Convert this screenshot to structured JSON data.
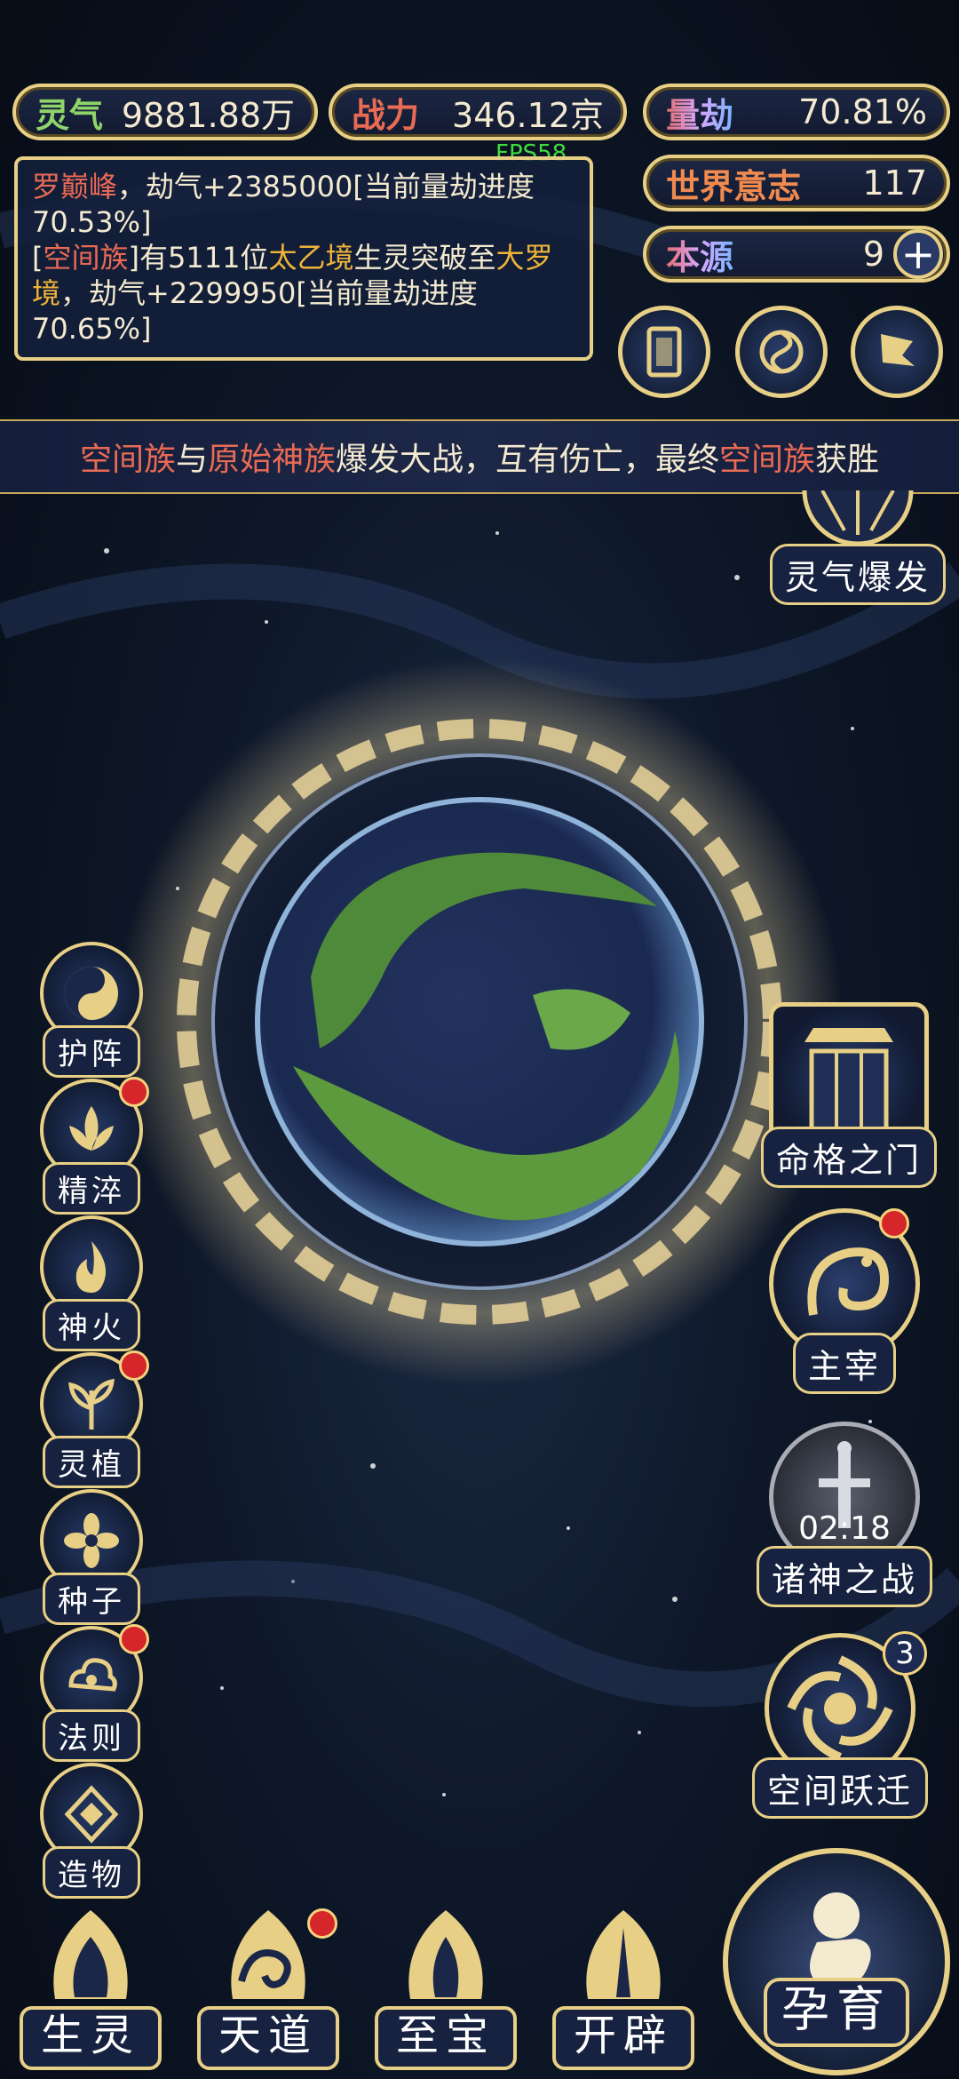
{
  "stats": {
    "lingqi": {
      "label": "灵气",
      "value": "9881.88万"
    },
    "zhanli": {
      "label": "战力",
      "value": "346.12京"
    },
    "liangjie": {
      "label": "量劫",
      "value": "70.81%"
    },
    "world_will": {
      "label": "世界意志",
      "value": "117"
    },
    "benyuan": {
      "label": "本源",
      "value": "9"
    }
  },
  "fps": "FPS58",
  "log": {
    "line1_name": "罗巅峰",
    "line1_text": "，劫气+2385000[当前量劫进度70.53%]",
    "line2_open": "[",
    "line2_clan": "空间族",
    "line2_mid": "]有5111位",
    "line2_realm1": "太乙境",
    "line2_mid2": "生灵突破至",
    "line2_realm2": "大罗境",
    "line2_end": "，劫气+2299950[当前量劫进度70.65%]"
  },
  "banner": {
    "clan_a": "空间族",
    "and": "与",
    "clan_b": "原始神族",
    "mid": "爆发大战，互有伤亡，最终",
    "winner": "空间族",
    "end": "获胜"
  },
  "right_buttons": {
    "lingqi_burst": "灵气爆发",
    "fate_gate": "命格之门",
    "ruler": "主宰",
    "gods_war": "诸神之战",
    "gods_war_timer": "02:18",
    "space_jump": "空间跃迁",
    "space_jump_count": "3"
  },
  "left_skills": [
    "护阵",
    "精淬",
    "神火",
    "灵植",
    "种子",
    "法则",
    "造物"
  ],
  "bottom_buttons": [
    "生灵",
    "天道",
    "至宝",
    "开辟"
  ],
  "main_button": "孕育",
  "colors": {
    "gold": "#e8cf86",
    "red_dot": "#d5262a",
    "highlight_red": "#e96a55",
    "highlight_gold": "#f0b43a"
  }
}
